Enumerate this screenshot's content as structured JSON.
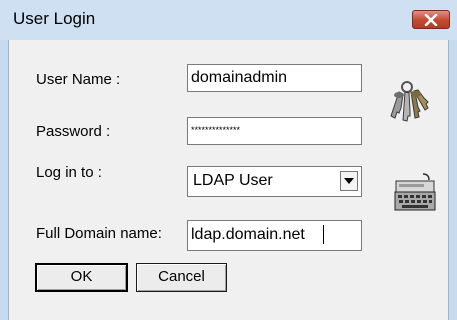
{
  "window": {
    "title": "User Login"
  },
  "form": {
    "username_label": "User Name :",
    "username_value": "domainadmin",
    "password_label": "Password :",
    "password_value": "**************",
    "login_to_label": "Log in to :",
    "login_to_value": "LDAP User",
    "domain_label": "Full Domain name:",
    "domain_value": "ldap.domain.net"
  },
  "buttons": {
    "ok": "OK",
    "cancel": "Cancel"
  },
  "icons": {
    "close": "close-icon",
    "keys": "keys-icon",
    "keyboard": "keyboard-icon",
    "dropdown": "dropdown-arrow-icon"
  },
  "colors": {
    "title_bar": "#cfe0f2",
    "close_button": "#c34a32",
    "dialog_bg": "#f0f0f0"
  }
}
